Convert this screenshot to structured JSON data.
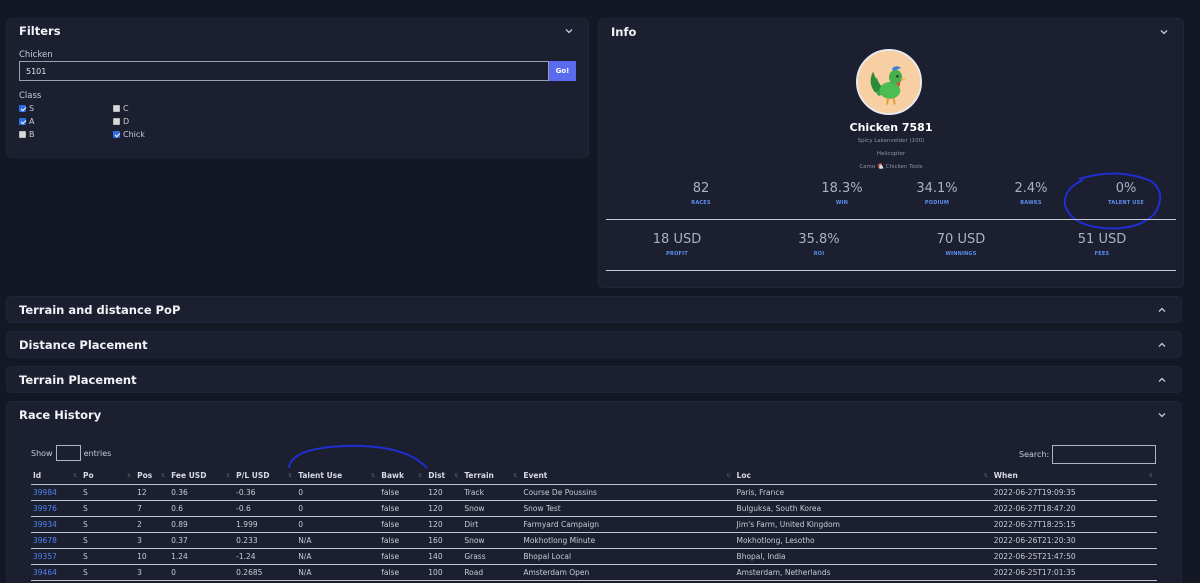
{
  "filters": {
    "title": "Filters",
    "chicken_label": "Chicken",
    "chicken_value": "5101",
    "go_label": "Go!",
    "class_label": "Class",
    "classes": [
      {
        "label": "S",
        "checked": true
      },
      {
        "label": "A",
        "checked": true
      },
      {
        "label": "B",
        "checked": false
      },
      {
        "label": "C",
        "checked": false
      },
      {
        "label": "D",
        "checked": false
      },
      {
        "label": "Chick",
        "checked": true
      }
    ]
  },
  "info": {
    "title": "Info",
    "name": "Chicken 7581",
    "breed": "Spicy Lakenvelder (100)",
    "heritage": "Helicopter",
    "tools": "Camo 🐔 Chicken Tools",
    "stats_row1": [
      {
        "value": "82",
        "label": "RACES"
      },
      {
        "value": "18.3%",
        "label": "WIN"
      },
      {
        "value": "34.1%",
        "label": "PODIUM"
      },
      {
        "value": "2.4%",
        "label": "BAWKS"
      },
      {
        "value": "0%",
        "label": "TALENT USE"
      }
    ],
    "stats_row2": [
      {
        "value": "18 USD",
        "label": "PROFIT"
      },
      {
        "value": "35.8%",
        "label": "ROI"
      },
      {
        "value": "70 USD",
        "label": "WINNINGS"
      },
      {
        "value": "51 USD",
        "label": "FEES"
      }
    ]
  },
  "sections": {
    "terrain_pop": "Terrain and distance PoP",
    "distance_placement": "Distance Placement",
    "terrain_placement": "Terrain Placement"
  },
  "history": {
    "title": "Race History",
    "show_label": "Show",
    "entries_label": "entries",
    "search_label": "Search:",
    "columns": [
      "Id",
      "Po",
      "Pos",
      "Fee USD",
      "P/L USD",
      "Talent Use",
      "Bawk",
      "Dist",
      "Terrain",
      "Event",
      "Loc",
      "When"
    ],
    "rows": [
      [
        "39984",
        "S",
        "12",
        "0.36",
        "-0.36",
        "0",
        "false",
        "120",
        "Track",
        "Course De Poussins",
        "Paris, France",
        "2022-06-27T19:09:35"
      ],
      [
        "39976",
        "S",
        "7",
        "0.6",
        "-0.6",
        "0",
        "false",
        "120",
        "Snow",
        "Snow Test",
        "Bulguksa, South Korea",
        "2022-06-27T18:47:20"
      ],
      [
        "39934",
        "S",
        "2",
        "0.89",
        "1.999",
        "0",
        "false",
        "120",
        "Dirt",
        "Farmyard Campaign",
        "Jim's Farm, United Kingdom",
        "2022-06-27T18:25:15"
      ],
      [
        "39678",
        "S",
        "3",
        "0.37",
        "0.233",
        "N/A",
        "false",
        "160",
        "Snow",
        "Mokhotlong Minute",
        "Mokhotlong, Lesotho",
        "2022-06-26T21:20:30"
      ],
      [
        "39357",
        "S",
        "10",
        "1.24",
        "-1.24",
        "N/A",
        "false",
        "140",
        "Grass",
        "Bhopal Local",
        "Bhopal, India",
        "2022-06-25T21:47:50"
      ],
      [
        "39464",
        "S",
        "3",
        "0",
        "0.2685",
        "N/A",
        "false",
        "100",
        "Road",
        "Amsterdam Open",
        "Amsterdam, Netherlands",
        "2022-06-25T17:01:35"
      ]
    ]
  }
}
